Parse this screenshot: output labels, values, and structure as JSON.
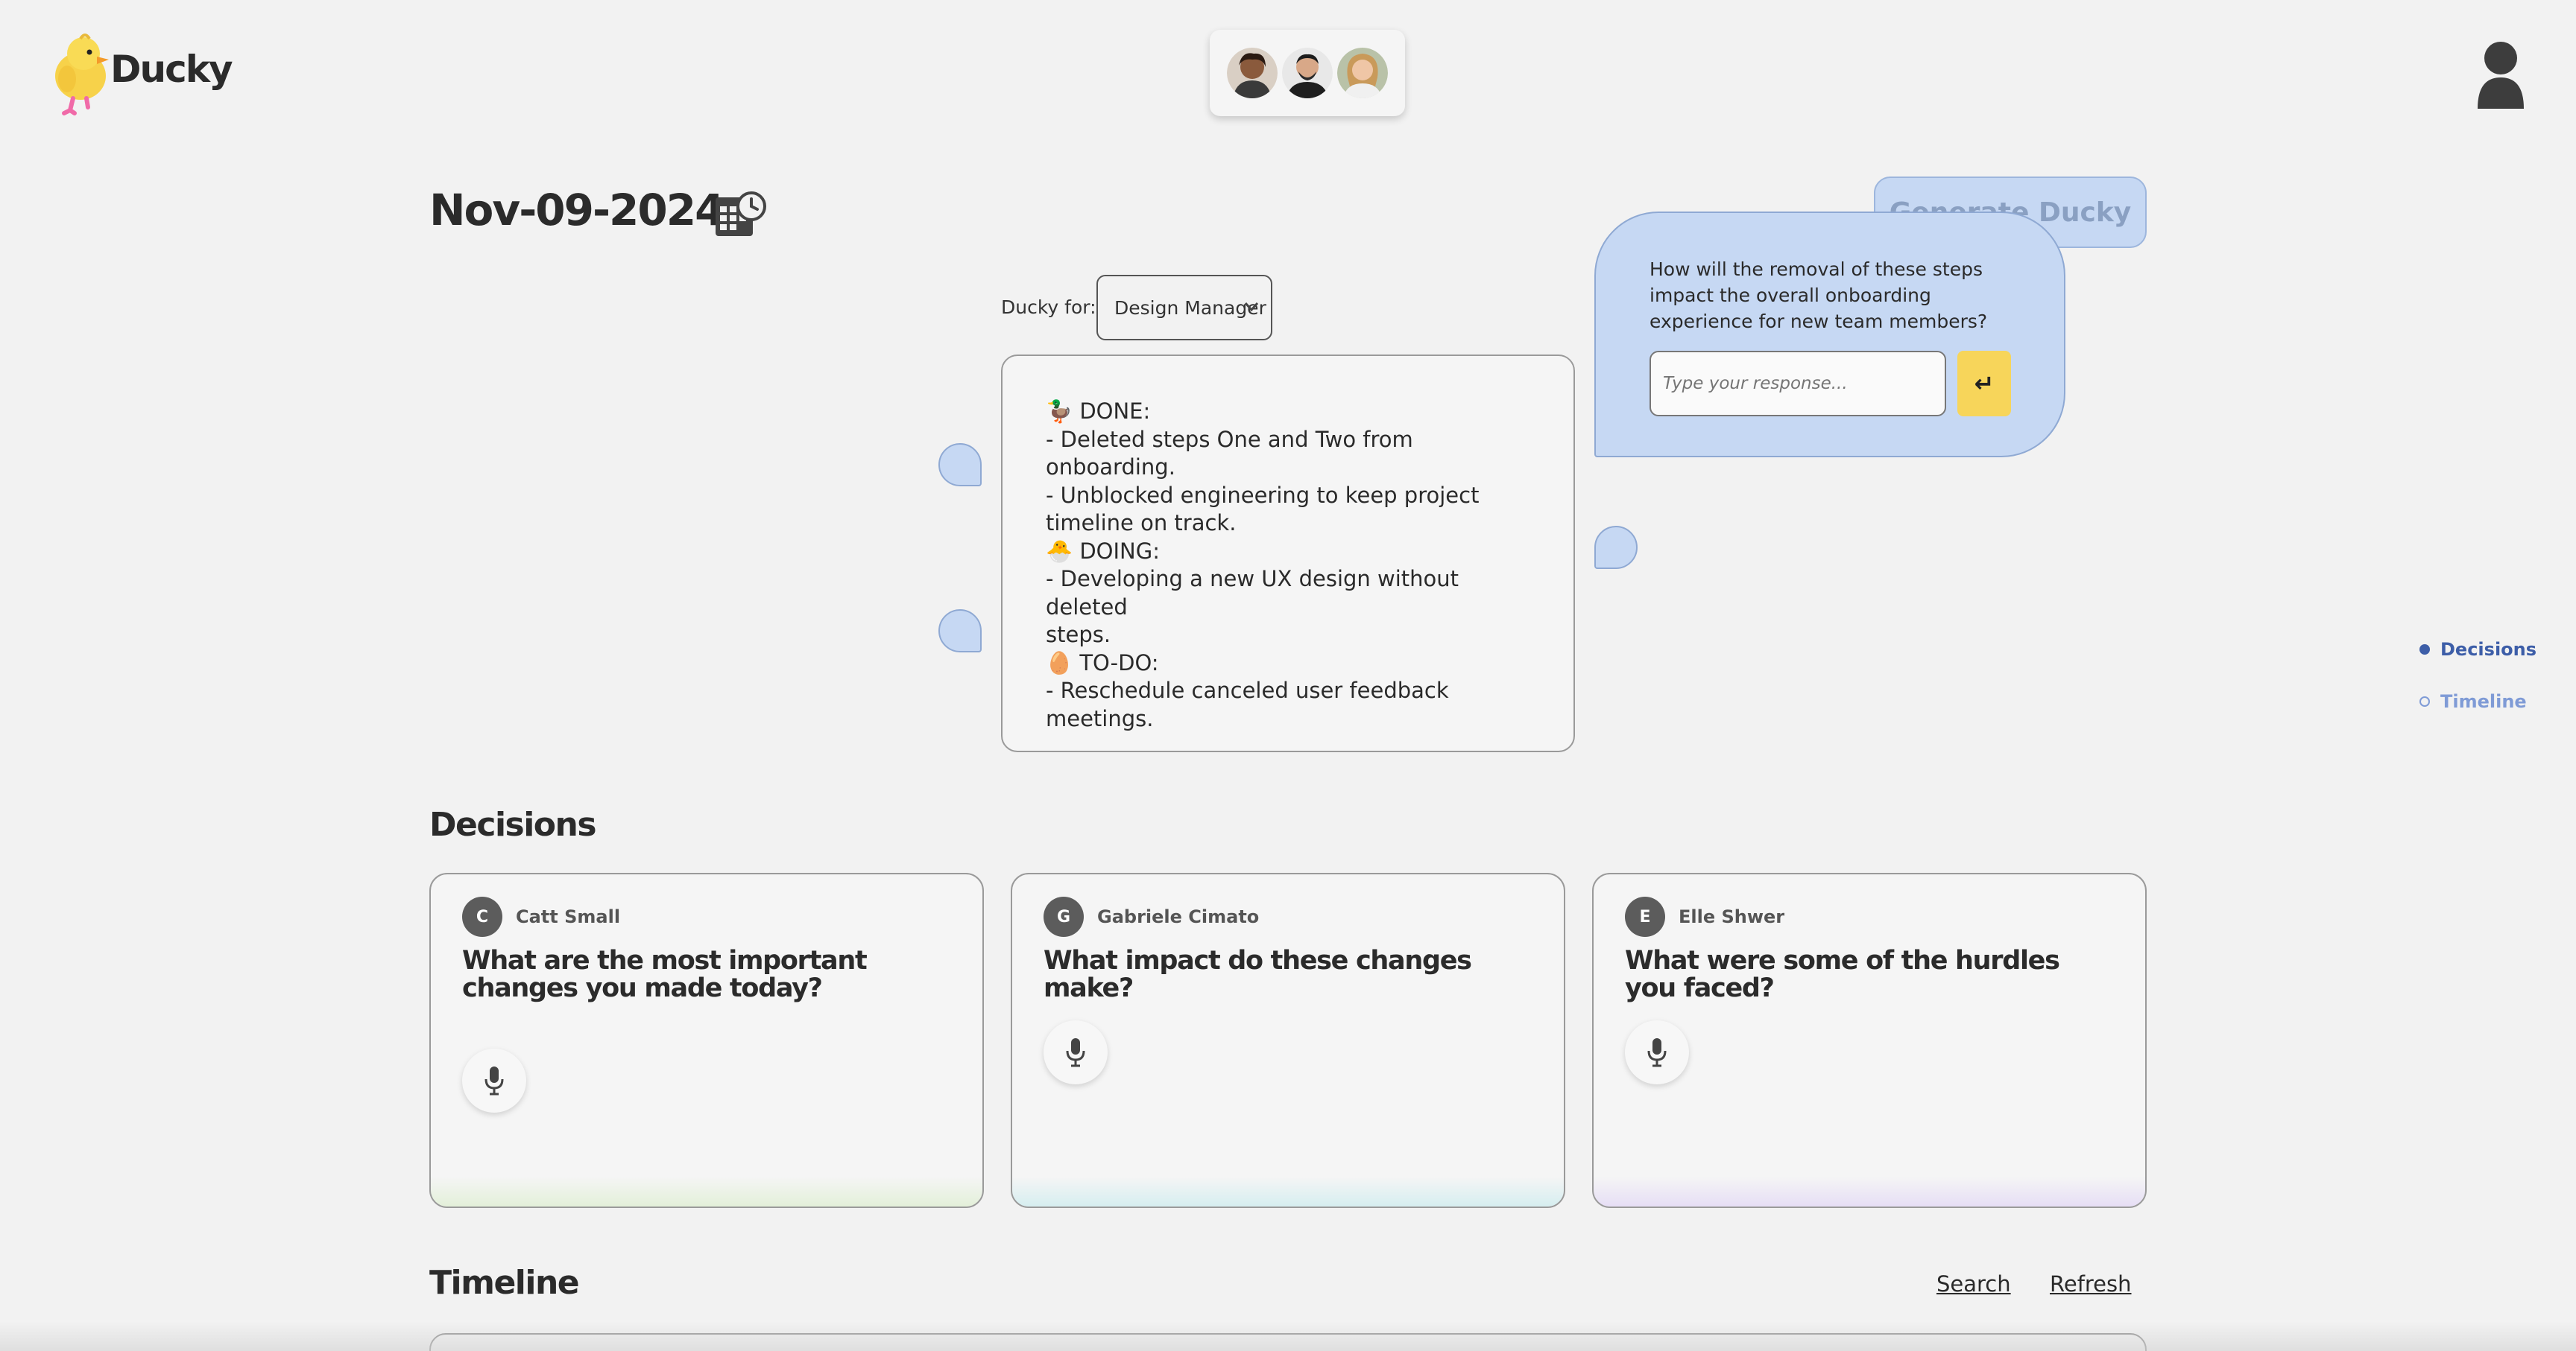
{
  "header": {
    "app_name": "Ducky"
  },
  "date": "Nov-09-2024",
  "ducky_for": {
    "label": "Ducky for:",
    "selected": "Design Manager"
  },
  "summary": {
    "lines": [
      "🦆 DONE:",
      "- Deleted steps One and Two from onboarding.",
      "- Unblocked engineering to keep project",
      "timeline on track.",
      "🐣 DOING:",
      "- Developing a new UX design without deleted",
      "steps.",
      "🥚 TO-DO:",
      "- Reschedule canceled user feedback",
      "meetings."
    ]
  },
  "generate_button": "Generate Ducky",
  "prompt": {
    "question": "How will the removal of these steps impact the overall onboarding experience for new team members?",
    "placeholder": "Type your response...",
    "enter_symbol": "↵"
  },
  "side_nav": {
    "items": [
      "Decisions",
      "Timeline"
    ]
  },
  "decisions": {
    "title": "Decisions",
    "cards": [
      {
        "initial": "C",
        "name": "Catt Small",
        "question": "What are the most important changes you made today?",
        "glow": "#e3f0d9"
      },
      {
        "initial": "G",
        "name": "Gabriele Cimato",
        "question": "What impact do these changes make?",
        "glow": "#d6eef0"
      },
      {
        "initial": "E",
        "name": "Elle Shwer",
        "question": "What were some of the hurdles you faced?",
        "glow": "#e6def5"
      }
    ]
  },
  "timeline": {
    "title": "Timeline",
    "search": "Search",
    "refresh": "Refresh"
  }
}
